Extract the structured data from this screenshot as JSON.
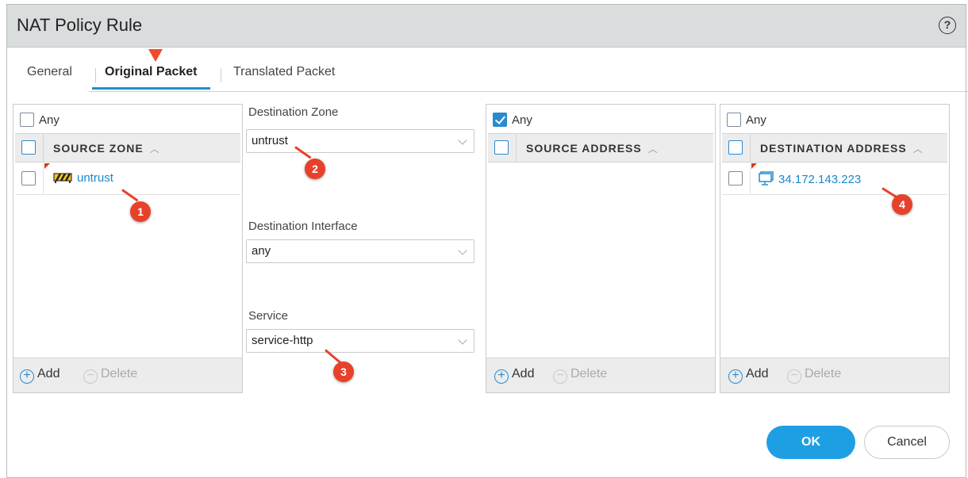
{
  "dialog": {
    "title": "NAT Policy Rule",
    "help": "?"
  },
  "tabs": [
    {
      "label": "General"
    },
    {
      "label": "Original Packet"
    },
    {
      "label": "Translated Packet"
    }
  ],
  "source_zone": {
    "any_label": "Any",
    "column": "SOURCE ZONE",
    "rows": [
      {
        "name": "untrust"
      }
    ],
    "add_label": "Add",
    "delete_label": "Delete"
  },
  "destination_zone": {
    "label": "Destination Zone",
    "value": "untrust"
  },
  "destination_interface": {
    "label": "Destination Interface",
    "value": "any"
  },
  "service": {
    "label": "Service",
    "value": "service-http"
  },
  "source_address": {
    "any_label": "Any",
    "any_checked": true,
    "column": "SOURCE ADDRESS",
    "add_label": "Add",
    "delete_label": "Delete"
  },
  "destination_address": {
    "any_label": "Any",
    "column": "DESTINATION ADDRESS",
    "rows": [
      {
        "address": "34.172.143.223"
      }
    ],
    "add_label": "Add",
    "delete_label": "Delete"
  },
  "callouts": [
    "1",
    "2",
    "3",
    "4"
  ],
  "buttons": {
    "ok": "OK",
    "cancel": "Cancel"
  },
  "colors": {
    "accent": "#1f9fe3",
    "callout": "#e8412b",
    "link": "#1a87c9"
  }
}
